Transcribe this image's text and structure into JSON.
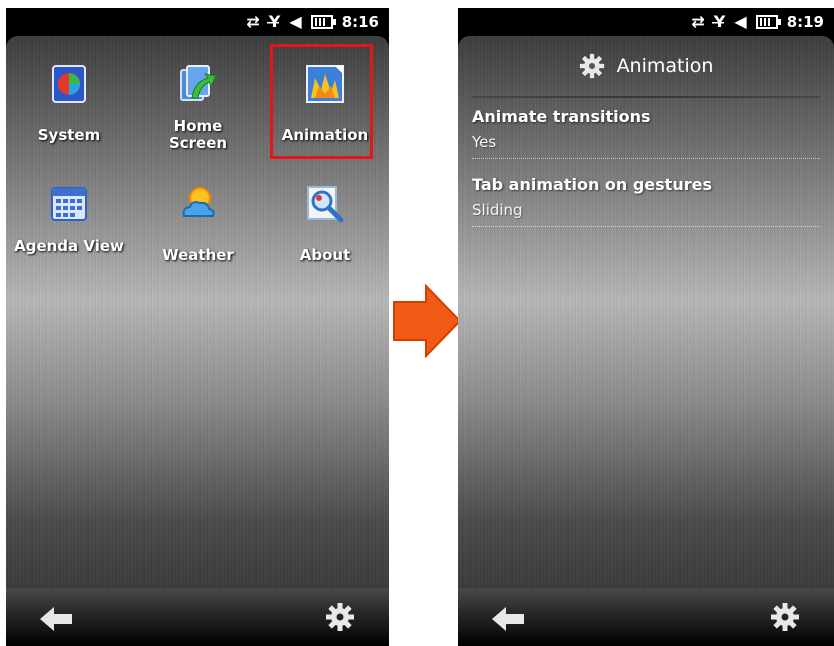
{
  "left_screen": {
    "status": {
      "time": "8:16"
    },
    "menu_items": [
      {
        "label": "System",
        "icon": "system-icon"
      },
      {
        "label": "Home Screen",
        "icon": "home-screen-icon"
      },
      {
        "label": "Animation",
        "icon": "animation-icon",
        "highlighted": true
      },
      {
        "label": "Agenda View",
        "icon": "calendar-icon"
      },
      {
        "label": "Weather",
        "icon": "weather-icon"
      },
      {
        "label": "About",
        "icon": "about-icon"
      }
    ]
  },
  "transition_arrow": {
    "color": "#f05a14",
    "icon": "arrow-right-icon"
  },
  "right_screen": {
    "status": {
      "time": "8:19"
    },
    "title": "Animation",
    "settings": [
      {
        "label": "Animate transitions",
        "value": "Yes"
      },
      {
        "label": "Tab animation on gestures",
        "value": "Sliding"
      }
    ]
  },
  "colors": {
    "highlight": "#e8141b",
    "arrow": "#f05a14"
  }
}
